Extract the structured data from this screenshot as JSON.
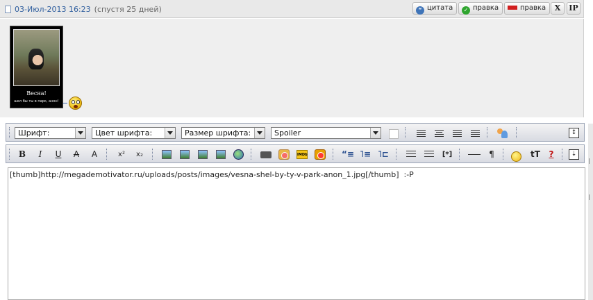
{
  "post": {
    "date": "03-Июл-2013 16:23",
    "since": "(спустя 25 дней)",
    "buttons": {
      "quote": "цитата",
      "edit": "правка",
      "edit_admin": "правка",
      "delete": "X",
      "ip": "IP"
    },
    "image": {
      "caption_title": "Весна!",
      "caption_sub": "шел бы ты в парк, анон!"
    }
  },
  "editor": {
    "font_select": "Шрифт:",
    "color_select": "Цвет шрифта:",
    "size_select": "Размер шрифта:",
    "tag_select": "Spoiler",
    "format": {
      "bold": "B",
      "italic": "I",
      "underline": "U",
      "strike": "A",
      "shadow": "A",
      "superscript": "x²",
      "subscript": "x₂",
      "list_code": "[*]",
      "paragraph": "¶",
      "font_size": "tT",
      "help": "?"
    },
    "text": "[thumb]http://megademotivator.ru/uploads/posts/images/vesna-shel-by-ty-v-park-anon_1.jpg[/thumb]  :-P"
  },
  "icons": {
    "quote": "quote-icon",
    "edit": "checkmark-icon",
    "edit_admin": "minus-icon",
    "smiley": "surprised-smiley-icon"
  }
}
